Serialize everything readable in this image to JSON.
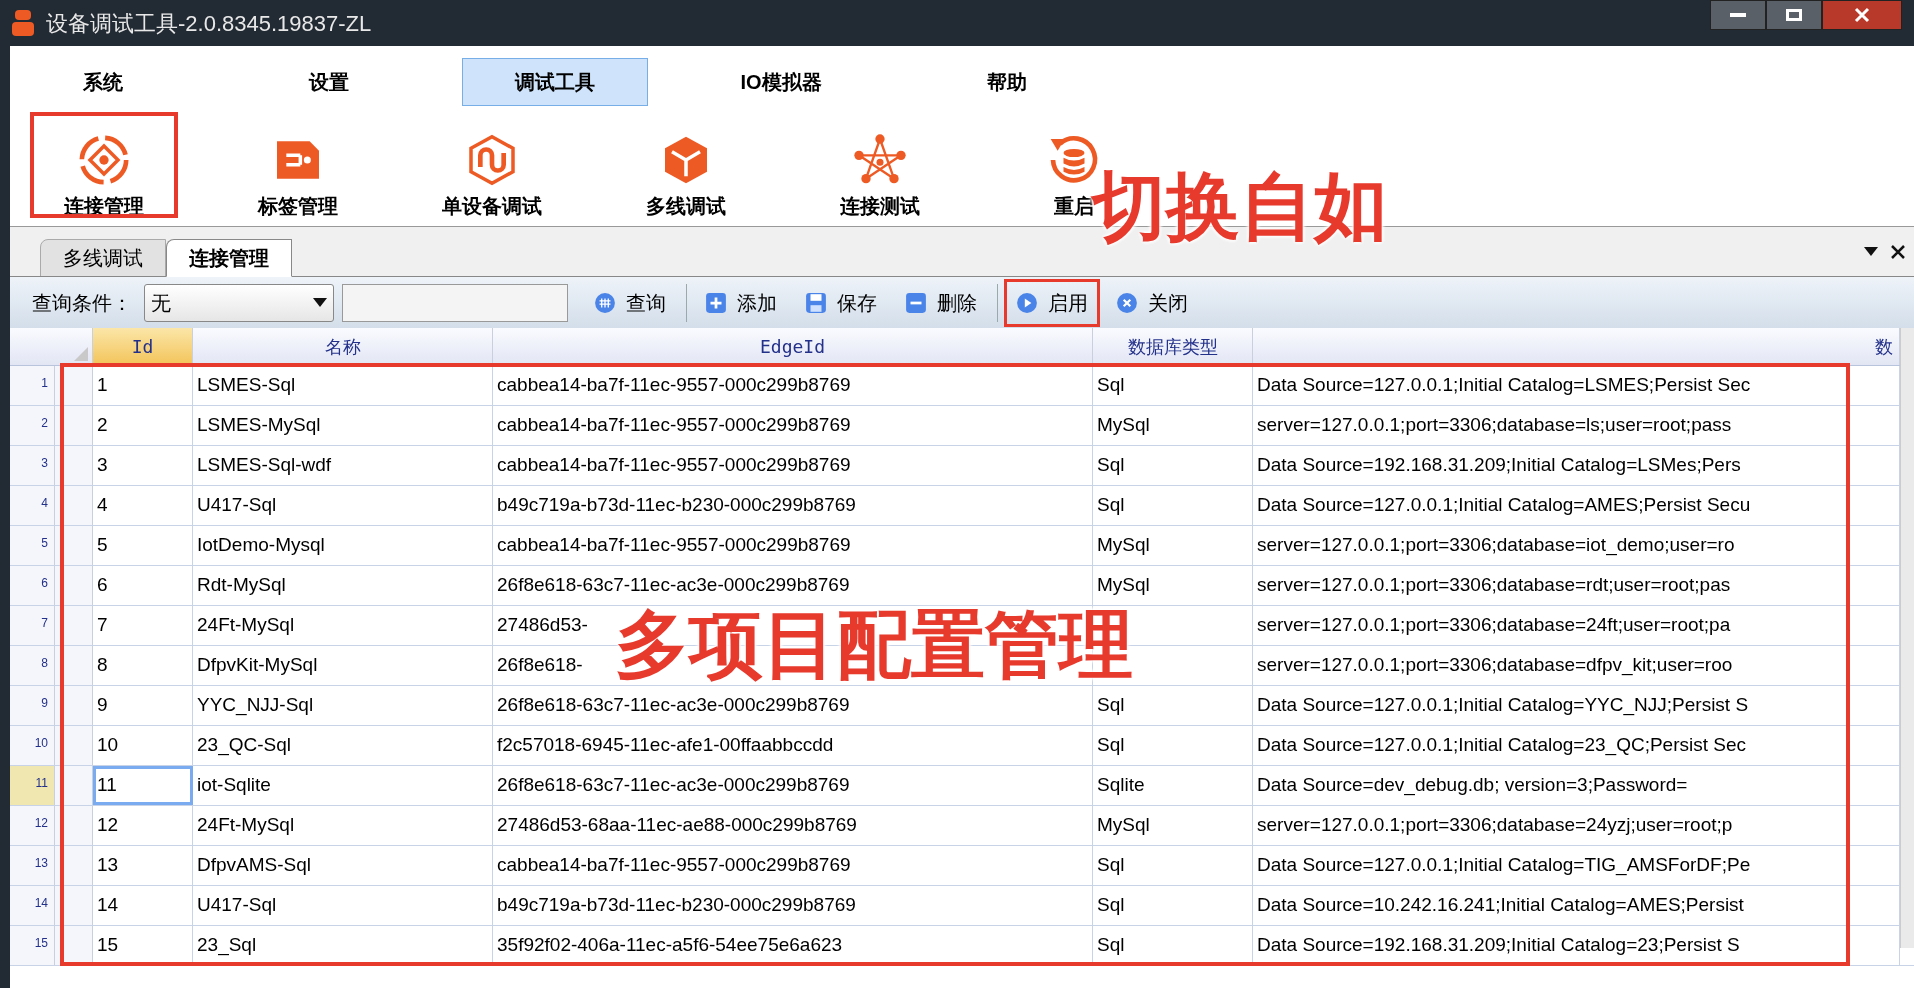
{
  "window": {
    "title": "设备调试工具-2.0.8345.19837-ZL"
  },
  "menu_tabs": [
    {
      "label": "系统",
      "selected": false
    },
    {
      "label": "设置",
      "selected": false
    },
    {
      "label": "调试工具",
      "selected": true
    },
    {
      "label": "IO模拟器",
      "selected": false
    },
    {
      "label": "帮助",
      "selected": false
    }
  ],
  "ribbon": [
    {
      "label": "连接管理",
      "kind": "target",
      "highlighted": true
    },
    {
      "label": "标签管理",
      "kind": "tag",
      "highlighted": false
    },
    {
      "label": "单设备调试",
      "kind": "link",
      "highlighted": false
    },
    {
      "label": "多线调试",
      "kind": "cube",
      "highlighted": false
    },
    {
      "label": "连接测试",
      "kind": "network",
      "highlighted": false
    },
    {
      "label": "重启",
      "kind": "restart",
      "highlighted": false
    }
  ],
  "doc_tabs": [
    {
      "label": "多线调试",
      "selected": false
    },
    {
      "label": "连接管理",
      "selected": true
    }
  ],
  "toolbar": {
    "query_label": "查询条件：",
    "condition": "无",
    "button_groups": [
      [
        {
          "label": "查询",
          "kind": "search",
          "highlighted": false
        }
      ],
      [
        {
          "label": "添加",
          "kind": "add",
          "highlighted": false
        },
        {
          "label": "保存",
          "kind": "save",
          "highlighted": false
        },
        {
          "label": "删除",
          "kind": "delete",
          "highlighted": false
        }
      ],
      [
        {
          "label": "启用",
          "kind": "play",
          "highlighted": true
        },
        {
          "label": "关闭",
          "kind": "close",
          "highlighted": false
        }
      ]
    ]
  },
  "table": {
    "columns": [
      {
        "label": "Id",
        "current": true
      },
      {
        "label": "名称",
        "current": false
      },
      {
        "label": "EdgeId",
        "current": false
      },
      {
        "label": "数据库类型",
        "current": false
      },
      {
        "label": "数",
        "current": false
      }
    ],
    "rows": [
      {
        "number": "1",
        "selected": false,
        "id": "1",
        "name": "LSMES-Sql",
        "edge_id": "cabbea14-ba7f-11ec-9557-000c299b8769",
        "db_type": "Sql",
        "connection": "Data Source=127.0.0.1;Initial Catalog=LSMES;Persist Sec"
      },
      {
        "number": "2",
        "selected": false,
        "id": "2",
        "name": "LSMES-MySql",
        "edge_id": "cabbea14-ba7f-11ec-9557-000c299b8769",
        "db_type": "MySql",
        "connection": "server=127.0.0.1;port=3306;database=ls;user=root;pass"
      },
      {
        "number": "3",
        "selected": false,
        "id": "3",
        "name": "LSMES-Sql-wdf",
        "edge_id": "cabbea14-ba7f-11ec-9557-000c299b8769",
        "db_type": "Sql",
        "connection": "Data Source=192.168.31.209;Initial Catalog=LSMes;Pers"
      },
      {
        "number": "4",
        "selected": false,
        "id": "4",
        "name": "U417-Sql",
        "edge_id": "b49c719a-b73d-11ec-b230-000c299b8769",
        "db_type": "Sql",
        "connection": "Data Source=127.0.0.1;Initial Catalog=AMES;Persist Secu"
      },
      {
        "number": "5",
        "selected": false,
        "id": "5",
        "name": "IotDemo-Mysql",
        "edge_id": "cabbea14-ba7f-11ec-9557-000c299b8769",
        "db_type": "MySql",
        "connection": "server=127.0.0.1;port=3306;database=iot_demo;user=ro"
      },
      {
        "number": "6",
        "selected": false,
        "id": "6",
        "name": "Rdt-MySql",
        "edge_id": "26f8e618-63c7-11ec-ac3e-000c299b8769",
        "db_type": "MySql",
        "connection": "server=127.0.0.1;port=3306;database=rdt;user=root;pas"
      },
      {
        "number": "7",
        "selected": false,
        "id": "7",
        "name": "24Ft-MySql",
        "edge_id": "27486d53-",
        "connection": "server=127.0.0.1;port=3306;database=24ft;user=root;pa"
      },
      {
        "number": "8",
        "selected": false,
        "id": "8",
        "name": "DfpvKit-MySql",
        "edge_id": "26f8e618-",
        "connection": "server=127.0.0.1;port=3306;database=dfpv_kit;user=roo"
      },
      {
        "number": "9",
        "selected": false,
        "id": "9",
        "name": "YYC_NJJ-Sql",
        "edge_id": "26f8e618-63c7-11ec-ac3e-000c299b8769",
        "db_type": "Sql",
        "connection": "Data Source=127.0.0.1;Initial Catalog=YYC_NJJ;Persist S"
      },
      {
        "number": "10",
        "selected": false,
        "id": "10",
        "name": "23_QC-Sql",
        "edge_id": "f2c57018-6945-11ec-afe1-00ffaabbccdd",
        "db_type": "Sql",
        "connection": "Data Source=127.0.0.1;Initial Catalog=23_QC;Persist Sec"
      },
      {
        "number": "11",
        "selected": true,
        "id": "11",
        "name": "iot-Sqlite",
        "edge_id": "26f8e618-63c7-11ec-ac3e-000c299b8769",
        "db_type": "Sqlite",
        "connection": "Data Source=dev_debug.db; version=3;Password="
      },
      {
        "number": "12",
        "selected": false,
        "id": "12",
        "name": "24Ft-MySql",
        "edge_id": "27486d53-68aa-11ec-ae88-000c299b8769",
        "db_type": "MySql",
        "connection": "server=127.0.0.1;port=3306;database=24yzj;user=root;p"
      },
      {
        "number": "13",
        "selected": false,
        "id": "13",
        "name": "DfpvAMS-Sql",
        "edge_id": "cabbea14-ba7f-11ec-9557-000c299b8769",
        "db_type": "Sql",
        "connection": "Data Source=127.0.0.1;Initial Catalog=TIG_AMSForDF;Pe"
      },
      {
        "number": "14",
        "selected": false,
        "id": "14",
        "name": "U417-Sql",
        "edge_id": "b49c719a-b73d-11ec-b230-000c299b8769",
        "db_type": "Sql",
        "connection": "Data Source=10.242.16.241;Initial Catalog=AMES;Persist"
      },
      {
        "number": "15",
        "selected": false,
        "id": "15",
        "name": "23_Sql",
        "edge_id": "35f92f02-406a-11ec-a5f6-54ee75e6a623",
        "db_type": "Sql",
        "connection": "Data Source=192.168.31.209;Initial Catalog=23;Persist S"
      }
    ]
  },
  "annotations": [
    {
      "text": "切换自如",
      "kind": "toolbar"
    },
    {
      "text": "多项目配置管理",
      "kind": "grid"
    }
  ]
}
